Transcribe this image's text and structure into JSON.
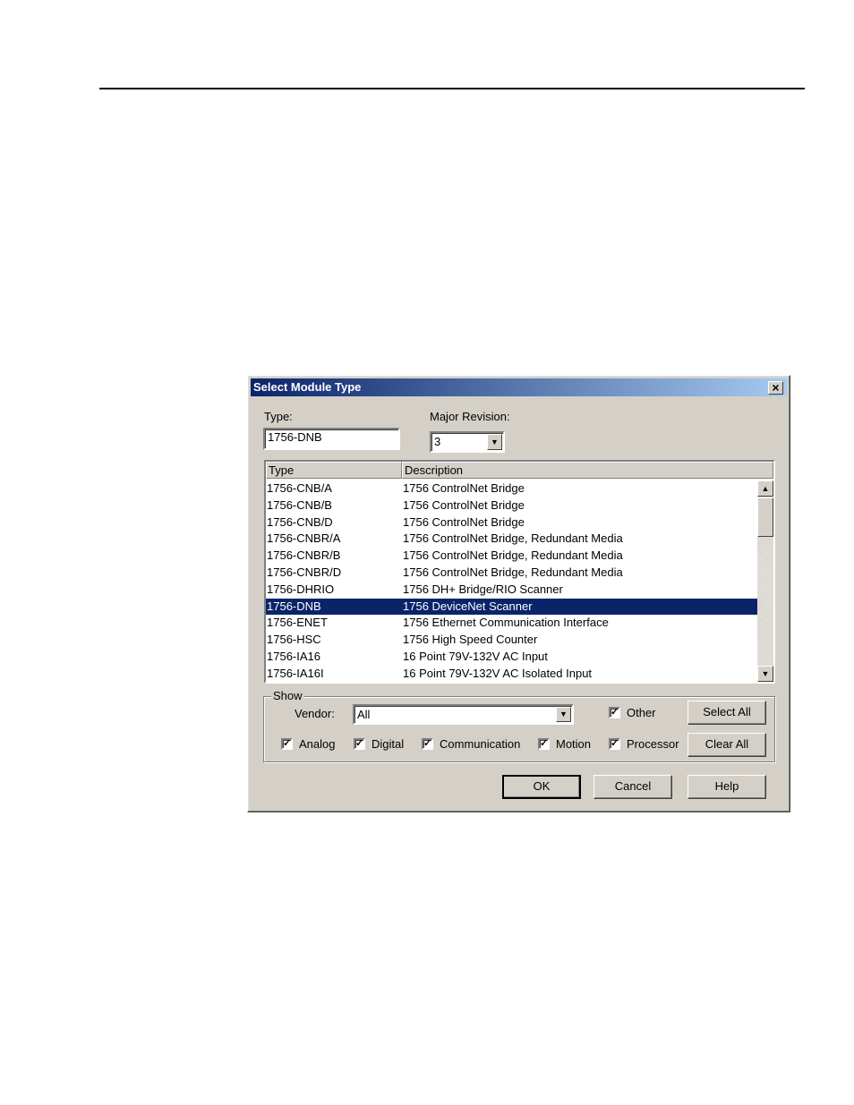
{
  "dialog": {
    "title": "Select Module Type",
    "close_glyph": "×"
  },
  "type_field": {
    "label": "Type:",
    "value": "1756-DNB"
  },
  "major_revision": {
    "label": "Major Revision:",
    "value": "3"
  },
  "list": {
    "columns": [
      "Type",
      "Description"
    ],
    "rows": [
      {
        "type": "1756-CNB/A",
        "description": "1756 ControlNet Bridge"
      },
      {
        "type": "1756-CNB/B",
        "description": "1756 ControlNet Bridge"
      },
      {
        "type": "1756-CNB/D",
        "description": "1756 ControlNet Bridge"
      },
      {
        "type": "1756-CNBR/A",
        "description": "1756 ControlNet Bridge, Redundant Media"
      },
      {
        "type": "1756-CNBR/B",
        "description": "1756 ControlNet Bridge, Redundant Media"
      },
      {
        "type": "1756-CNBR/D",
        "description": "1756 ControlNet Bridge, Redundant Media"
      },
      {
        "type": "1756-DHRIO",
        "description": "1756 DH+ Bridge/RIO Scanner"
      },
      {
        "type": "1756-DNB",
        "description": "1756 DeviceNet Scanner"
      },
      {
        "type": "1756-ENET",
        "description": "1756 Ethernet Communication Interface"
      },
      {
        "type": "1756-HSC",
        "description": "1756 High Speed Counter"
      },
      {
        "type": "1756-IA16",
        "description": "16 Point 79V-132V AC Input"
      },
      {
        "type": "1756-IA16I",
        "description": "16 Point 79V-132V AC Isolated Input"
      }
    ],
    "selected_index": 7
  },
  "show": {
    "legend": "Show",
    "vendor_label": "Vendor:",
    "vendor_value": "All",
    "other": {
      "label": "Other",
      "checked": true
    },
    "filters": [
      {
        "label": "Analog",
        "checked": true
      },
      {
        "label": "Digital",
        "checked": true
      },
      {
        "label": "Communication",
        "checked": true
      },
      {
        "label": "Motion",
        "checked": true
      },
      {
        "label": "Processor",
        "checked": true
      }
    ],
    "select_all": "Select All",
    "clear_all": "Clear All"
  },
  "buttons": {
    "ok": "OK",
    "cancel": "Cancel",
    "help": "Help"
  },
  "glyphs": {
    "check": "✓",
    "down": "▼",
    "up": "▲"
  },
  "colors": {
    "title_start": "#0a246a",
    "title_end": "#a6caf0",
    "selection": "#0a246a",
    "face": "#d4d0c8"
  }
}
